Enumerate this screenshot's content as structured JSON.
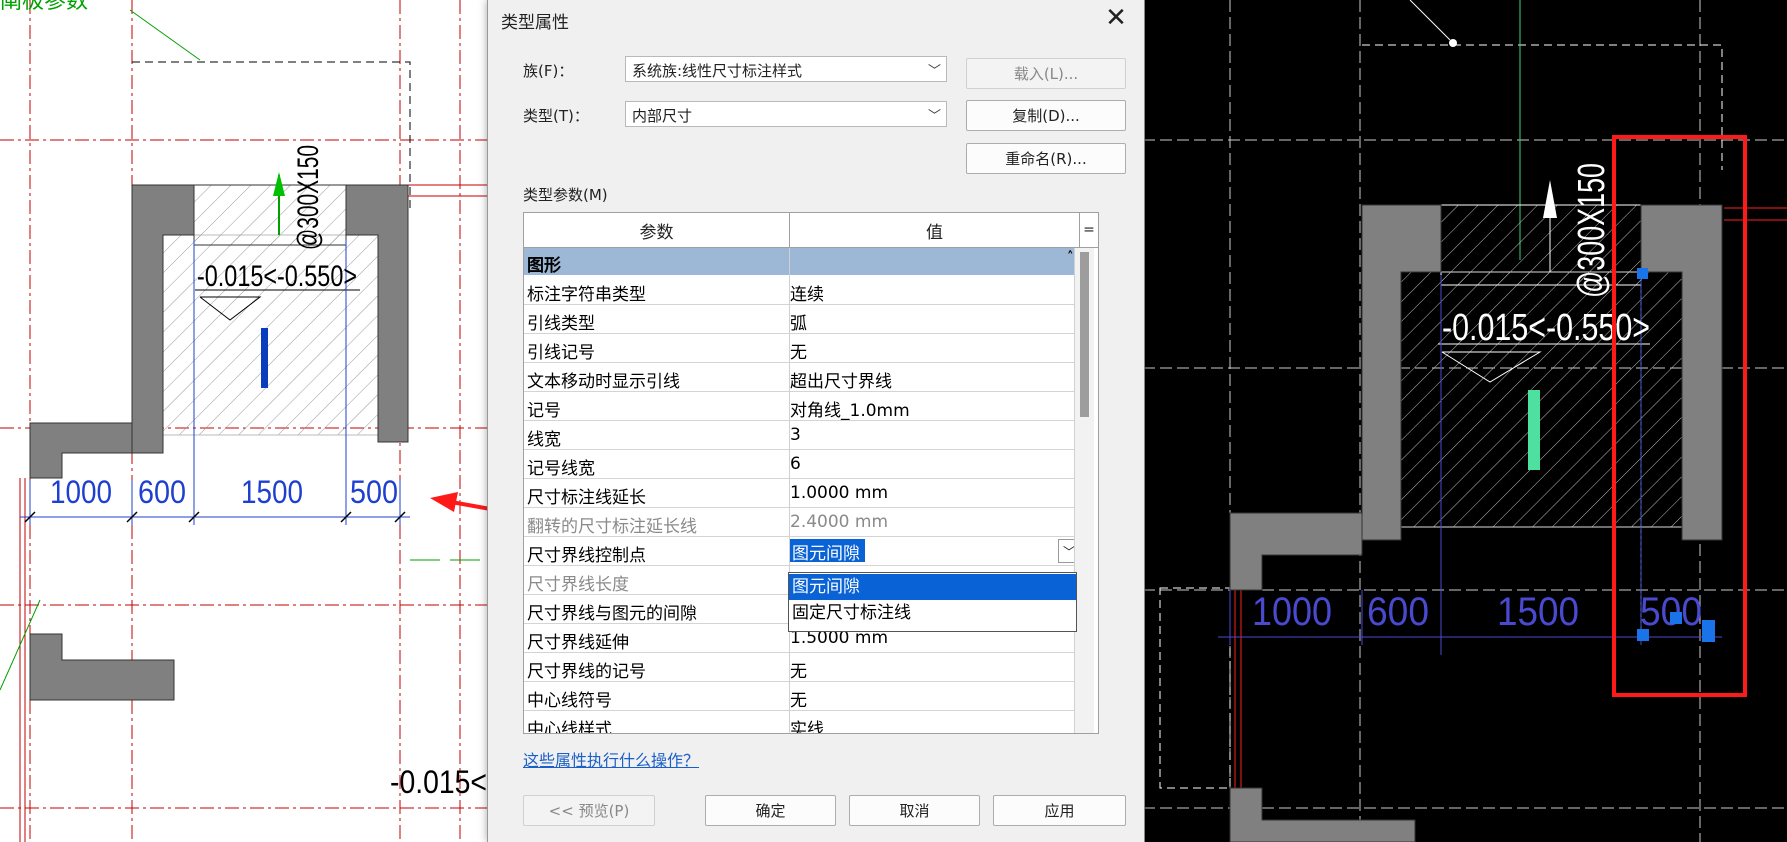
{
  "cad_left": {
    "labels": {
      "top_left_fragment": "阐极参数",
      "rebar": "@300X150",
      "level": "-0.015<-0.550>",
      "level_bottom": "-0.015<"
    },
    "dims": [
      "1000",
      "600",
      "1500",
      "500"
    ]
  },
  "cad_right": {
    "labels": {
      "rebar": "@300X150",
      "level": "-0.015<-0.550>"
    },
    "dims": [
      "1000",
      "600",
      "1500",
      "500"
    ]
  },
  "dialog": {
    "title": "类型属性",
    "close_icon": "close-icon",
    "family_label": "族(F)：",
    "family_value": "系统族:线性尺寸标注样式",
    "type_label": "类型(T)：",
    "type_value": "内部尺寸",
    "load_button": "载入(L)...",
    "duplicate_button": "复制(D)...",
    "rename_button": "重命名(R)...",
    "type_params_label": "类型参数(M)",
    "col_param": "参数",
    "col_value": "值",
    "col_eq": "=",
    "group": "图形",
    "rows": [
      {
        "param": "标注字符串类型",
        "value": "连续",
        "disabled": false
      },
      {
        "param": "引线类型",
        "value": "弧",
        "disabled": false
      },
      {
        "param": "引线记号",
        "value": "无",
        "disabled": false
      },
      {
        "param": "文本移动时显示引线",
        "value": "超出尺寸界线",
        "disabled": false
      },
      {
        "param": "记号",
        "value": "对角线_1.0mm",
        "disabled": false
      },
      {
        "param": "线宽",
        "value": "3",
        "disabled": false
      },
      {
        "param": "记号线宽",
        "value": "6",
        "disabled": false
      },
      {
        "param": "尺寸标注线延长",
        "value": "1.0000 mm",
        "disabled": false
      },
      {
        "param": "翻转的尺寸标注延长线",
        "value": "2.4000 mm",
        "disabled": true
      },
      {
        "param": "尺寸界线控制点",
        "value": "图元间隙",
        "disabled": false
      },
      {
        "param": "尺寸界线长度",
        "value": "",
        "disabled": true
      },
      {
        "param": "尺寸界线与图元的间隙",
        "value": "",
        "disabled": false
      },
      {
        "param": "尺寸界线延伸",
        "value": "1.5000 mm",
        "disabled": false
      },
      {
        "param": "尺寸界线的记号",
        "value": "无",
        "disabled": false
      },
      {
        "param": "中心线符号",
        "value": "无",
        "disabled": false
      },
      {
        "param": "中心线样式",
        "value": "实线",
        "disabled": false
      }
    ],
    "dropdown_options": [
      "图元间隙",
      "固定尺寸标注线"
    ],
    "help_link": "这些属性执行什么操作？",
    "preview_button": "<< 预览(P)",
    "ok_button": "确定",
    "cancel_button": "取消",
    "apply_button": "应用"
  },
  "colors": {
    "cad_white": "#ffffff",
    "cad_black": "#000000",
    "wall_gray": "#808080",
    "dim_blue": "#1f3fd0",
    "highlight_red": "#ff1a1a",
    "selection_blue": "#0a63d6",
    "group_header": "#9cb8d6"
  }
}
